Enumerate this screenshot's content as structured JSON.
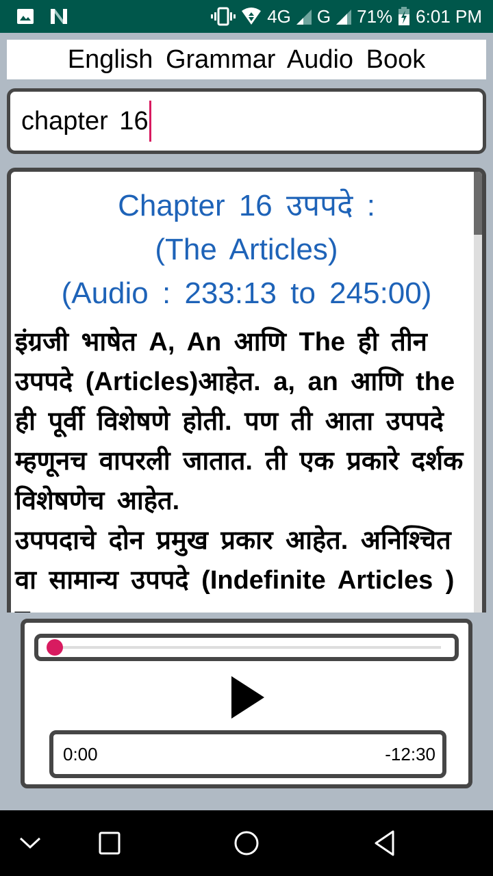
{
  "status_bar": {
    "left_icons": [
      "gallery-icon",
      "n-logo-icon"
    ],
    "right_icons": [
      "vibrate-icon",
      "wifi-icon",
      "signal-4g-icon",
      "signal-g-icon",
      "battery-charging-icon"
    ],
    "network_1": "4G",
    "network_2": "G",
    "battery": "71%",
    "time": "6:01 PM"
  },
  "header": {
    "title": "English Grammar Audio Book"
  },
  "search": {
    "value": "chapter 16",
    "caret_color": "#d81b60"
  },
  "content": {
    "heading_lines": [
      "Chapter 16 उपपदे :",
      "(The Articles)",
      "(Audio : 233:13 to 245:00)"
    ],
    "heading_color": "#1e63b8",
    "paragraphs": [
      "इंग्रजी भाषेत  A, An आणि  The ही तीन उपपदे (Articles)आहेत.  a, an आणि the ही पूर्वी विशेषणे होती. पण ती आता उपपदे म्हणूनच वापरली जातात. ती एक प्रकारे दर्शक विशेषणेच आहेत.",
      "उपपदाचे दोन प्रमुख प्रकार आहेत. अनिश्चित वा सामान्य उपपदे (Indefinite Articles ) व"
    ]
  },
  "player": {
    "progress_fraction": 0.0,
    "accent_color": "#d81b60",
    "play_icon": "play-icon",
    "elapsed": "0:00",
    "remaining": "-12:30"
  },
  "nav_bar": {
    "buttons": [
      "collapse-chevron-icon",
      "recents-icon",
      "home-icon",
      "back-icon"
    ]
  }
}
